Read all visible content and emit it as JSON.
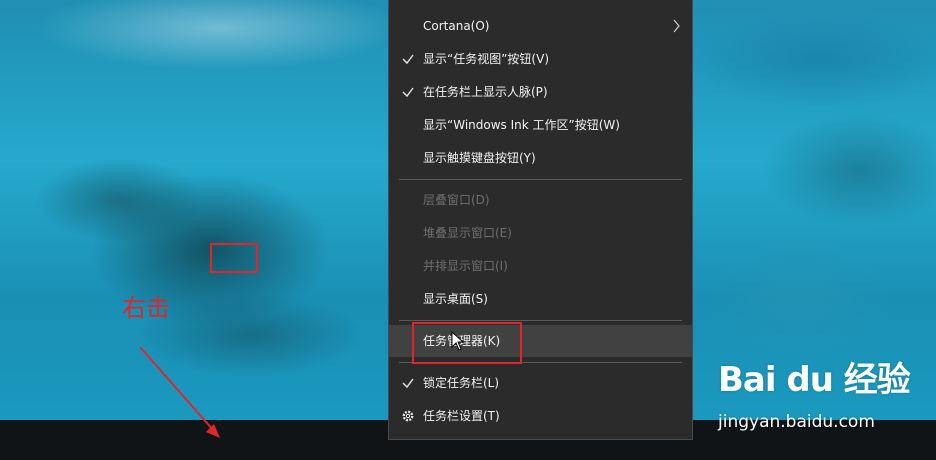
{
  "context_menu": {
    "items": [
      {
        "label": "Cortana(O)",
        "has_submenu": true
      },
      {
        "label": "显示“任务视图”按钮(V)",
        "checked": true
      },
      {
        "label": "在任务栏上显示人脉(P)",
        "checked": true
      },
      {
        "label": "显示“Windows Ink 工作区”按钮(W)"
      },
      {
        "label": "显示触摸键盘按钮(Y)"
      },
      {
        "label": "层叠窗口(D)",
        "disabled": true
      },
      {
        "label": "堆叠显示窗口(E)",
        "disabled": true
      },
      {
        "label": "并排显示窗口(I)",
        "disabled": true
      },
      {
        "label": "显示桌面(S)"
      },
      {
        "label": "任务管理器(K)",
        "highlighted": true
      },
      {
        "label": "锁定任务栏(L)",
        "checked": true
      },
      {
        "label": "任务栏设置(T)",
        "icon": "gear-icon"
      }
    ]
  },
  "annotation": {
    "label": "右击",
    "color": "#e0262a"
  },
  "watermark": {
    "brand": "Bai du 经验",
    "url": "jingyan.baidu.com"
  },
  "colors": {
    "menu_bg": "#2b2b2b",
    "menu_text": "#f2f2f2",
    "menu_disabled": "#6e6e6e",
    "menu_highlight": "#414141",
    "taskbar": "#101417",
    "annotation": "#e0262a"
  }
}
